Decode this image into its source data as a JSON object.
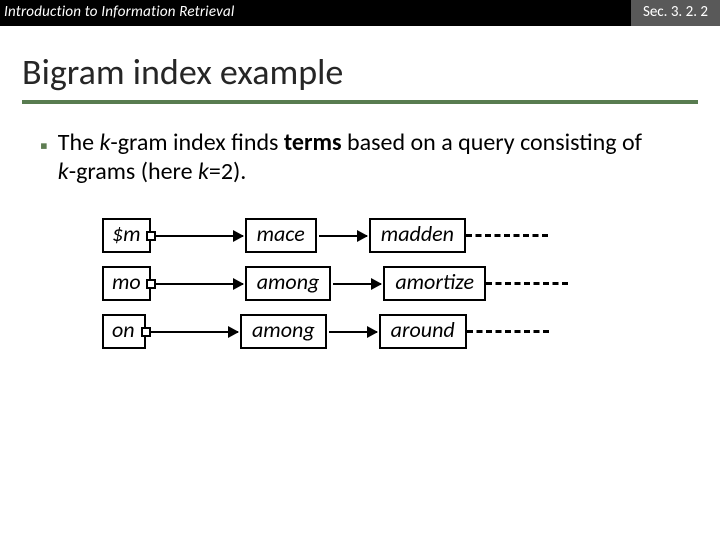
{
  "header": {
    "left": "Introduction to Information Retrieval",
    "right": "Sec. 3. 2. 2"
  },
  "title": "Bigram index example",
  "bullet": {
    "pre": "The ",
    "k": "k",
    "mid1": "-gram index finds ",
    "terms": "terms",
    "mid2": " based on a query consisting of ",
    "k2": "k",
    "mid3": "-grams (here ",
    "k3": "k",
    "tail": "=2)."
  },
  "chains": [
    {
      "key": "$m",
      "t1": "mace",
      "t2": "madden"
    },
    {
      "key": "mo",
      "t1": "among",
      "t2": "amortize"
    },
    {
      "key": "on",
      "t1": "among",
      "t2": "around"
    }
  ]
}
